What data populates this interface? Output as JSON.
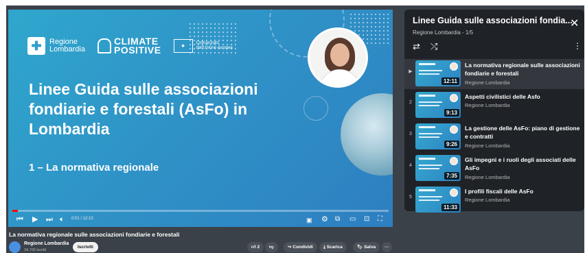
{
  "slide": {
    "org_logo": "Regione\nLombardia",
    "climate_logo": "CLIMATE\nPOSITIVE",
    "climate_small": "LIFE",
    "eu_logo": "Cofinanziato\ndall'Unione europea",
    "title": "Linee Guida sulle associazioni fondiarie e forestali (AsFo) in Lombardia",
    "subtitle": "1 – La normativa regionale"
  },
  "player": {
    "time": "0:01 / 12:10",
    "progress_fraction": 0.002,
    "icons": [
      "previous-icon",
      "play-icon",
      "next-icon",
      "volume-icon",
      "subtitles-icon",
      "settings-icon",
      "miniplayer-icon",
      "theater-icon",
      "cast-icon",
      "fullscreen-icon"
    ]
  },
  "video": {
    "title": "La normativa regionale sulle associazioni fondiarie e forestali",
    "channel": "Regione Lombardia",
    "subscribers": "34.700 iscritti",
    "subscribe_label": "Iscriviti",
    "likes": "2",
    "share_label": "Condividi",
    "download_label": "Scarica",
    "save_label": "Salva",
    "more_label": "···"
  },
  "playlist": {
    "title": "Linee Guida sulle associazioni fondia...",
    "subtitle": "Regione Lombardia - 1/5",
    "items": [
      {
        "index": "▶",
        "title": "La normativa regionale sulle associazioni fondiarie e forestali",
        "channel": "Regione Lombardia",
        "duration": "12:11"
      },
      {
        "index": "2",
        "title": "Aspetti civilistici delle Asfo",
        "channel": "Regione Lombardia",
        "duration": "9:13"
      },
      {
        "index": "3",
        "title": "La gestione delle AsFo: piano di gestione e contratti",
        "channel": "Regione Lombardia",
        "duration": "9:26"
      },
      {
        "index": "4",
        "title": "Gli impegni e i ruoli degli associati delle AsFo",
        "channel": "Regione Lombardia",
        "duration": "7:35"
      },
      {
        "index": "5",
        "title": "I profili fiscali delle AsFo",
        "channel": "Regione Lombardia",
        "duration": "11:33"
      }
    ]
  },
  "colors": {
    "background": "#3b4148",
    "slide_blue": "#2f93c7",
    "progress_red": "#ff0000",
    "panel": "#1f2227"
  }
}
